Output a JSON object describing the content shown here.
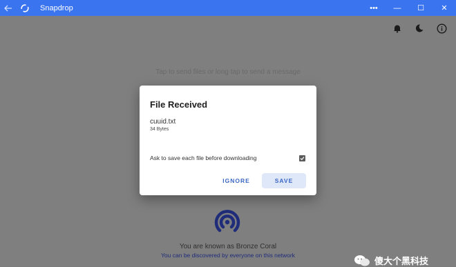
{
  "window": {
    "title": "Snapdrop",
    "controls": {
      "more": "•••",
      "minimize": "—",
      "maximize": "☐",
      "close": "✕"
    }
  },
  "app": {
    "hint": "Tap to send files or long tap to send a message",
    "known_as": "You are known as Bronze Coral",
    "discover_text": "You can be discovered by everyone on this network"
  },
  "dialog": {
    "title": "File Received",
    "file_name": "cuuid.txt",
    "file_size": "34 Bytes",
    "ask_label": "Ask to save each file before downloading",
    "ask_checked": true,
    "ignore_label": "IGNORE",
    "save_label": "SAVE"
  },
  "watermark": {
    "text": "傻大个黑科技"
  },
  "colors": {
    "titlebar": "#3b74ef",
    "accent": "#3b66c4",
    "save_bg": "#dfe8f8",
    "logo": "#1f2c7a"
  },
  "icons": [
    "back-arrow-icon",
    "sync-icon",
    "bell-icon",
    "moon-icon",
    "info-icon",
    "snapdrop-logo-icon",
    "wechat-icon"
  ]
}
